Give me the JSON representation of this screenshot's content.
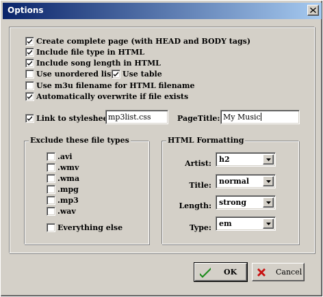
{
  "window": {
    "title": "Options"
  },
  "options": {
    "create_complete_page": {
      "label": "Create complete page (with HEAD and BODY tags)",
      "checked": true
    },
    "include_file_type": {
      "label": "Include file type in HTML",
      "checked": true
    },
    "include_song_length": {
      "label": "Include song length in HTML",
      "checked": true
    },
    "use_unordered_lists": {
      "label": "Use unordered lists",
      "checked": false
    },
    "use_table": {
      "label": "Use table",
      "checked": true
    },
    "use_m3u_filename": {
      "label": "Use m3u filename for HTML filename",
      "checked": false
    },
    "auto_overwrite": {
      "label": "Automatically overwrite if file exists",
      "checked": true
    }
  },
  "stylesheet": {
    "label": "Link to stylesheet:",
    "checked": true,
    "value": "mp3list.css"
  },
  "page_title": {
    "label": "PageTitle:",
    "value": "My Music"
  },
  "exclude": {
    "legend": "Exclude these file types",
    "types": [
      {
        "label": ".avi",
        "checked": false
      },
      {
        "label": ".wmv",
        "checked": false
      },
      {
        "label": ".wma",
        "checked": false
      },
      {
        "label": ".mpg",
        "checked": false
      },
      {
        "label": ".mp3",
        "checked": false
      },
      {
        "label": ".wav",
        "checked": false
      }
    ],
    "everything_else": {
      "label": "Everything else",
      "checked": false
    }
  },
  "formatting": {
    "legend": "HTML Formatting",
    "artist": {
      "label": "Artist:",
      "value": "h2"
    },
    "title": {
      "label": "Title:",
      "value": "normal"
    },
    "length": {
      "label": "Length:",
      "value": "strong"
    },
    "type": {
      "label": "Type:",
      "value": "em"
    }
  },
  "buttons": {
    "ok": "OK",
    "cancel": "Cancel"
  },
  "colors": {
    "ok_check": "#1a8a1a",
    "cancel_x": "#c81010",
    "titlebar_start": "#0a246a",
    "titlebar_end": "#a6caf0"
  }
}
